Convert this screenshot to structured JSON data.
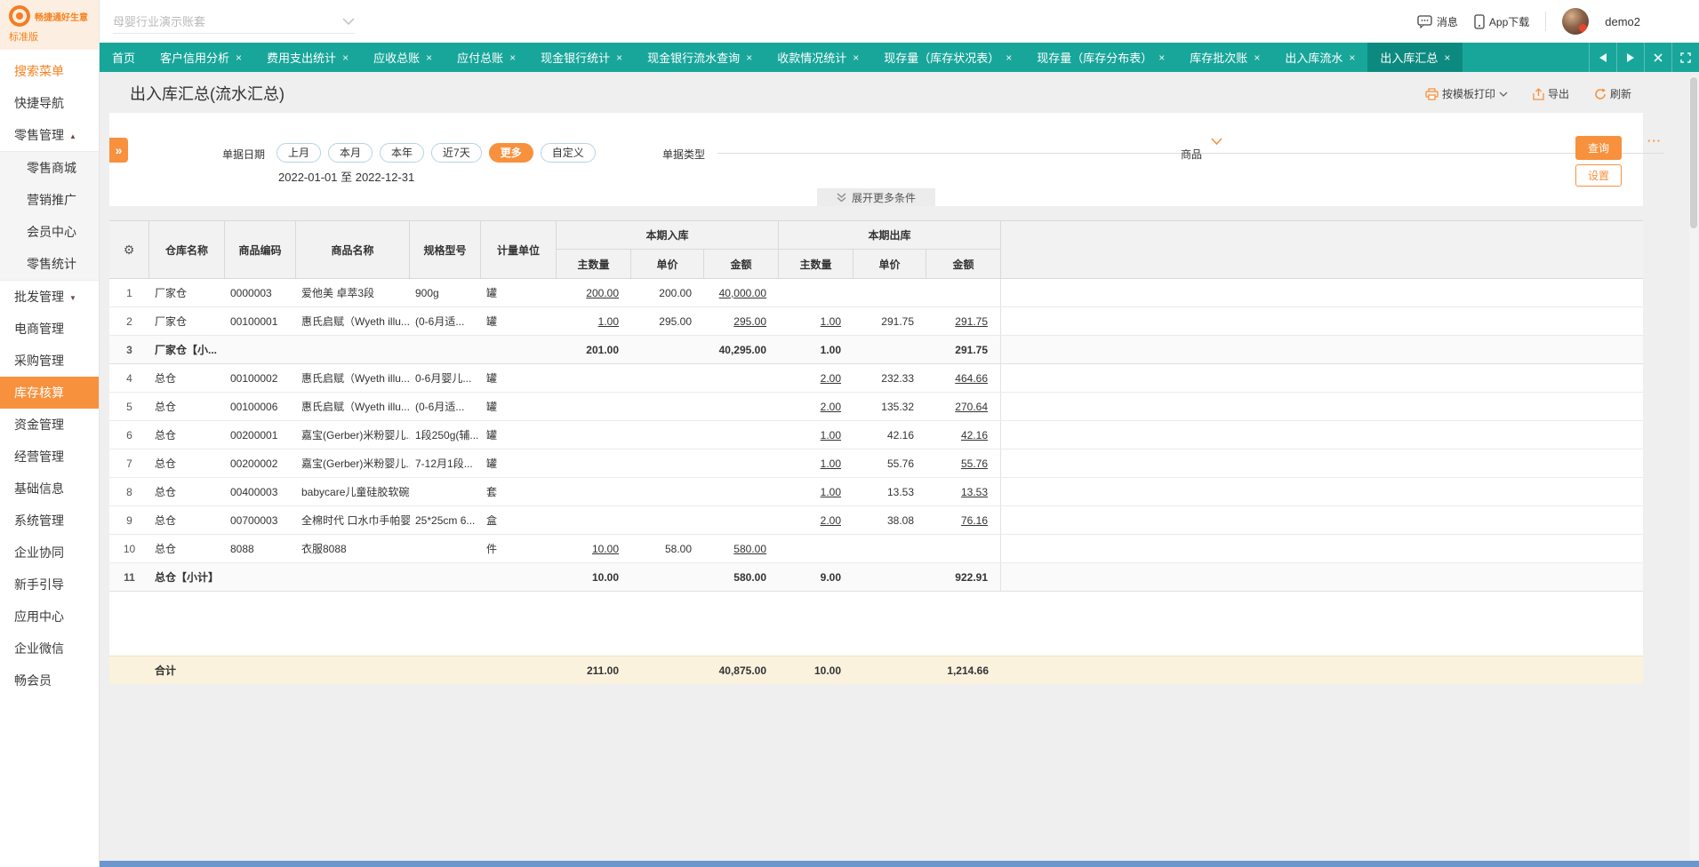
{
  "colors": {
    "teal": "#18a69b",
    "teal_dark": "#0d8a80",
    "orange": "#f7913e",
    "logo_orange": "#f57d24",
    "total_row_bg": "#fbf2de",
    "bottom_strip_blue": "#6c96ce"
  },
  "brand": {
    "logo_text": "畅捷通好生意",
    "edition": "标准版"
  },
  "topbar": {
    "account_placeholder": "母婴行业演示账套",
    "messages_label": "消息",
    "app_download_label": "App下载",
    "username": "demo2"
  },
  "tabs": {
    "items": [
      {
        "label": "首页",
        "closable": false,
        "active": false
      },
      {
        "label": "客户信用分析",
        "closable": true,
        "active": false
      },
      {
        "label": "费用支出统计",
        "closable": true,
        "active": false
      },
      {
        "label": "应收总账",
        "closable": true,
        "active": false
      },
      {
        "label": "应付总账",
        "closable": true,
        "active": false
      },
      {
        "label": "现金银行统计",
        "closable": true,
        "active": false
      },
      {
        "label": "现金银行流水查询",
        "closable": true,
        "active": false
      },
      {
        "label": "收款情况统计",
        "closable": true,
        "active": false
      },
      {
        "label": "现存量（库存状况表）",
        "closable": true,
        "active": false
      },
      {
        "label": "现存量（库存分布表）",
        "closable": true,
        "active": false
      },
      {
        "label": "库存批次账",
        "closable": true,
        "active": false
      },
      {
        "label": "出入库流水",
        "closable": true,
        "active": false
      },
      {
        "label": "出入库汇总",
        "closable": true,
        "active": true
      }
    ]
  },
  "sidebar": {
    "items": [
      {
        "label": "搜索菜单",
        "accent": true
      },
      {
        "label": "快捷导航"
      },
      {
        "label": "零售管理",
        "arrow": "up",
        "children": [
          "零售商城",
          "营销推广",
          "会员中心",
          "零售统计"
        ]
      },
      {
        "label": "批发管理",
        "arrow": "down"
      },
      {
        "label": "电商管理"
      },
      {
        "label": "采购管理"
      },
      {
        "label": "库存核算",
        "active": true
      },
      {
        "label": "资金管理"
      },
      {
        "label": "经营管理"
      },
      {
        "label": "基础信息"
      },
      {
        "label": "系统管理"
      },
      {
        "label": "企业协同"
      },
      {
        "label": "新手引导"
      },
      {
        "label": "应用中心"
      },
      {
        "label": "企业微信"
      },
      {
        "label": "畅会员"
      }
    ]
  },
  "page": {
    "title": "出入库汇总(流水汇总)",
    "toolbar": {
      "print_label": "按模板打印",
      "export_label": "导出",
      "refresh_label": "刷新"
    }
  },
  "filters": {
    "date_label": "单据日期",
    "date_presets": [
      "上月",
      "本月",
      "本年",
      "近7天",
      "更多",
      "自定义"
    ],
    "active_preset": "更多",
    "date_range": "2022-01-01 至 2022-12-31",
    "doc_type_label": "单据类型",
    "doc_type_value": "",
    "product_label": "商品",
    "product_value": "",
    "search_label": "查询",
    "settings_label": "设置",
    "expand_label": "展开更多条件"
  },
  "table": {
    "columns": {
      "warehouse": "仓库名称",
      "code": "商品编码",
      "name": "商品名称",
      "spec": "规格型号",
      "unit": "计量单位"
    },
    "group_in": "本期入库",
    "group_out": "本期出库",
    "sub": {
      "qty": "主数量",
      "price": "单价",
      "amount": "金额"
    },
    "rows": [
      {
        "no": "1",
        "warehouse": "厂家仓",
        "code": "0000003",
        "name": "爱他美 卓萃3段",
        "spec": "900g",
        "unit": "罐",
        "in_qty": "200.00",
        "in_price": "200.00",
        "in_amt": "40,000.00",
        "out_qty": "",
        "out_price": "",
        "out_amt": "",
        "subtotal": false
      },
      {
        "no": "2",
        "warehouse": "厂家仓",
        "code": "00100001",
        "name": "惠氏启赋（Wyeth illu...",
        "spec": "(0-6月适...",
        "unit": "罐",
        "in_qty": "1.00",
        "in_price": "295.00",
        "in_amt": "295.00",
        "out_qty": "1.00",
        "out_price": "291.75",
        "out_amt": "291.75",
        "subtotal": false
      },
      {
        "no": "3",
        "warehouse": "厂家仓【小...",
        "code": "",
        "name": "",
        "spec": "",
        "unit": "",
        "in_qty": "201.00",
        "in_price": "",
        "in_amt": "40,295.00",
        "out_qty": "1.00",
        "out_price": "",
        "out_amt": "291.75",
        "subtotal": true
      },
      {
        "no": "4",
        "warehouse": "总仓",
        "code": "00100002",
        "name": "惠氏启赋（Wyeth illu...",
        "spec": "0-6月婴儿...",
        "unit": "罐",
        "in_qty": "",
        "in_price": "",
        "in_amt": "",
        "out_qty": "2.00",
        "out_price": "232.33",
        "out_amt": "464.66",
        "subtotal": false
      },
      {
        "no": "5",
        "warehouse": "总仓",
        "code": "00100006",
        "name": "惠氏启赋（Wyeth illu...",
        "spec": "(0-6月适...",
        "unit": "罐",
        "in_qty": "",
        "in_price": "",
        "in_amt": "",
        "out_qty": "2.00",
        "out_price": "135.32",
        "out_amt": "270.64",
        "subtotal": false
      },
      {
        "no": "6",
        "warehouse": "总仓",
        "code": "00200001",
        "name": "嘉宝(Gerber)米粉婴儿...",
        "spec": "1段250g(辅...",
        "unit": "罐",
        "in_qty": "",
        "in_price": "",
        "in_amt": "",
        "out_qty": "1.00",
        "out_price": "42.16",
        "out_amt": "42.16",
        "subtotal": false
      },
      {
        "no": "7",
        "warehouse": "总仓",
        "code": "00200002",
        "name": "嘉宝(Gerber)米粉婴儿...",
        "spec": "7-12月1段...",
        "unit": "罐",
        "in_qty": "",
        "in_price": "",
        "in_amt": "",
        "out_qty": "1.00",
        "out_price": "55.76",
        "out_amt": "55.76",
        "subtotal": false
      },
      {
        "no": "8",
        "warehouse": "总仓",
        "code": "00400003",
        "name": "babycare儿童硅胶软碗...",
        "spec": "",
        "unit": "套",
        "in_qty": "",
        "in_price": "",
        "in_amt": "",
        "out_qty": "1.00",
        "out_price": "13.53",
        "out_amt": "13.53",
        "subtotal": false
      },
      {
        "no": "9",
        "warehouse": "总仓",
        "code": "00700003",
        "name": "全棉时代 口水巾手帕婴...",
        "spec": "25*25cm 6...",
        "unit": "盒",
        "in_qty": "",
        "in_price": "",
        "in_amt": "",
        "out_qty": "2.00",
        "out_price": "38.08",
        "out_amt": "76.16",
        "subtotal": false
      },
      {
        "no": "10",
        "warehouse": "总仓",
        "code": "8088",
        "name": "衣服8088",
        "spec": "",
        "unit": "件",
        "in_qty": "10.00",
        "in_price": "58.00",
        "in_amt": "580.00",
        "out_qty": "",
        "out_price": "",
        "out_amt": "",
        "subtotal": false
      },
      {
        "no": "11",
        "warehouse": "总仓【小计】",
        "code": "",
        "name": "",
        "spec": "",
        "unit": "",
        "in_qty": "10.00",
        "in_price": "",
        "in_amt": "580.00",
        "out_qty": "9.00",
        "out_price": "",
        "out_amt": "922.91",
        "subtotal": true
      }
    ],
    "total": {
      "label": "合计",
      "in_qty": "211.00",
      "in_amount": "40,875.00",
      "out_qty": "10.00",
      "out_amount": "1,214.66"
    }
  }
}
